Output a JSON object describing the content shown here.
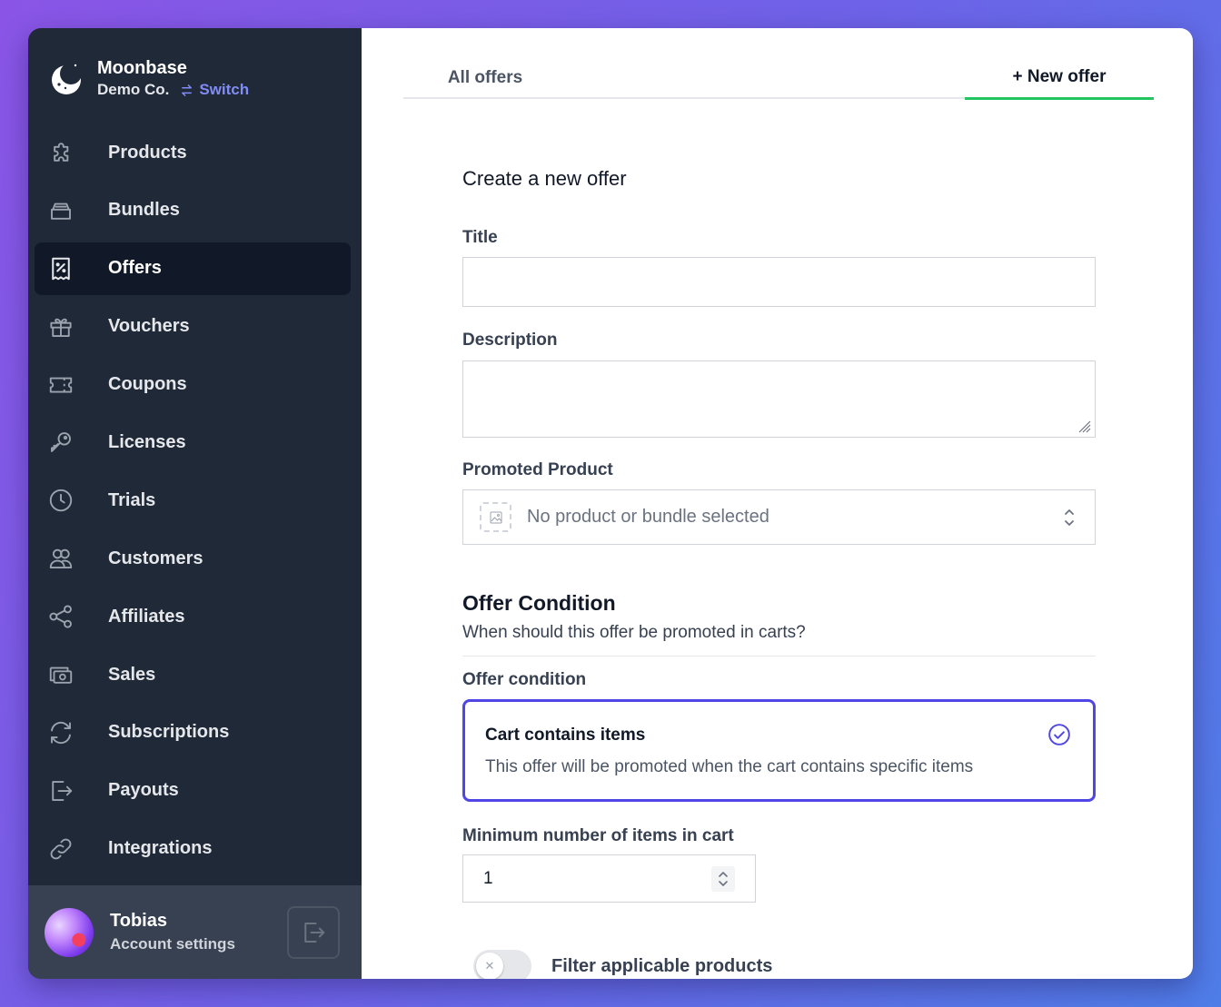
{
  "brand": {
    "name": "Moonbase",
    "org": "Demo Co.",
    "switch_label": "Switch"
  },
  "nav": {
    "items": [
      {
        "label": "Products",
        "icon": "puzzle-icon"
      },
      {
        "label": "Bundles",
        "icon": "box-icon"
      },
      {
        "label": "Offers",
        "icon": "receipt-percent-icon",
        "active": true
      },
      {
        "label": "Vouchers",
        "icon": "gift-icon"
      },
      {
        "label": "Coupons",
        "icon": "ticket-icon"
      },
      {
        "label": "Licenses",
        "icon": "key-icon"
      },
      {
        "label": "Trials",
        "icon": "clock-icon"
      },
      {
        "label": "Customers",
        "icon": "users-icon"
      },
      {
        "label": "Affiliates",
        "icon": "share-icon"
      },
      {
        "label": "Sales",
        "icon": "cash-icon"
      },
      {
        "label": "Subscriptions",
        "icon": "refresh-icon"
      },
      {
        "label": "Payouts",
        "icon": "arrow-right-box-icon"
      },
      {
        "label": "Integrations",
        "icon": "link-icon"
      }
    ]
  },
  "user": {
    "name": "Tobias",
    "subtitle": "Account settings"
  },
  "tabs": {
    "all": "All offers",
    "new": "+ New offer"
  },
  "form": {
    "heading": "Create a new offer",
    "title_label": "Title",
    "title_value": "",
    "description_label": "Description",
    "description_value": "",
    "promoted_label": "Promoted Product",
    "promoted_placeholder": "No product or bundle selected",
    "condition_section_title": "Offer Condition",
    "condition_section_sub": "When should this offer be promoted in carts?",
    "condition_label": "Offer condition",
    "condition_option_title": "Cart contains items",
    "condition_option_desc": "This offer will be promoted when the cart contains specific items",
    "min_items_label": "Minimum number of items in cart",
    "min_items_value": "1",
    "filter_toggle_label": "Filter applicable products",
    "filter_toggle_on": false
  },
  "colors": {
    "sidebar_bg": "#1f2937",
    "accent": "#4f46e5",
    "tab_active": "#22c55e",
    "switch_link": "#818cf8"
  }
}
